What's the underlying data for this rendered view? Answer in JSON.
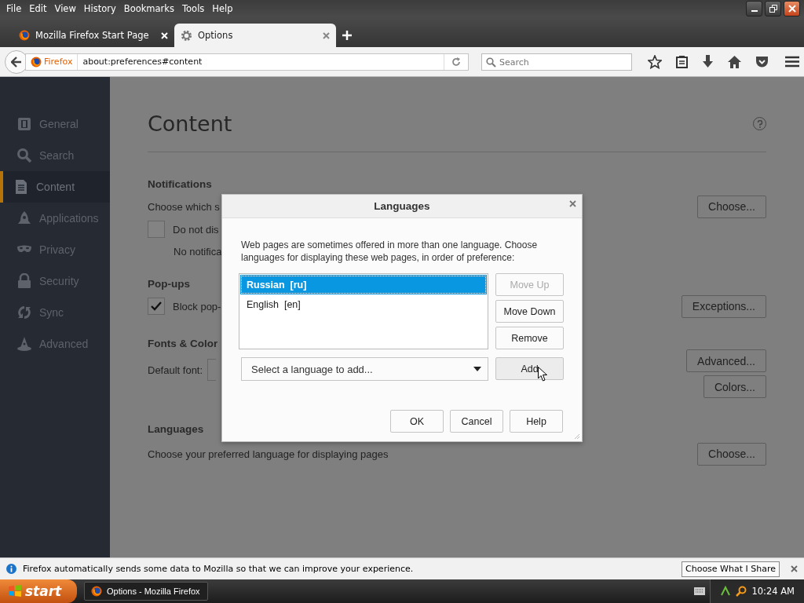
{
  "menu": [
    "File",
    "Edit",
    "View",
    "History",
    "Bookmarks",
    "Tools",
    "Help"
  ],
  "tabs": [
    {
      "label": "Mozilla Firefox Start Page",
      "selected": false,
      "kind": "firefox"
    },
    {
      "label": "Options",
      "selected": true,
      "kind": "gear"
    }
  ],
  "navbar": {
    "identity": "Firefox",
    "url": "about:preferences#content",
    "search": {
      "placeholder": "Search"
    }
  },
  "sidebar": {
    "items": [
      {
        "label": "General",
        "kind": "general",
        "selected": false
      },
      {
        "label": "Search",
        "kind": "search",
        "selected": false
      },
      {
        "label": "Content",
        "kind": "content",
        "selected": true
      },
      {
        "label": "Applications",
        "kind": "applications",
        "selected": false
      },
      {
        "label": "Privacy",
        "kind": "privacy",
        "selected": false
      },
      {
        "label": "Security",
        "kind": "security",
        "selected": false
      },
      {
        "label": "Sync",
        "kind": "sync",
        "selected": false
      },
      {
        "label": "Advanced",
        "kind": "advanced",
        "selected": false
      }
    ]
  },
  "content": {
    "title": "Content",
    "notifications": {
      "heading": "Notifications",
      "text": "Choose which s",
      "button": "Choose...",
      "checkbox": {
        "label": "Do not dis",
        "checked": false
      },
      "note": "No notifica"
    },
    "popups": {
      "heading": "Pop-ups",
      "checkbox": {
        "label": "Block pop-",
        "checked": true
      },
      "button": "Exceptions..."
    },
    "fonts": {
      "heading": "Fonts & Color",
      "label": "Default font:",
      "buttons": [
        "Advanced...",
        "Colors..."
      ]
    },
    "languages": {
      "heading": "Languages",
      "text": "Choose your preferred language for displaying pages",
      "button": "Choose..."
    }
  },
  "dialog": {
    "title": "Languages",
    "description": "Web pages are sometimes offered in more than one language. Choose languages for displaying these web pages, in order of preference:",
    "languages": [
      {
        "label": "Russian  [ru]",
        "selected": true
      },
      {
        "label": "English  [en]",
        "selected": false
      }
    ],
    "side_buttons": [
      {
        "label": "Move Up",
        "disabled": true
      },
      {
        "label": "Move Down",
        "disabled": false
      },
      {
        "label": "Remove",
        "disabled": false
      }
    ],
    "select": {
      "placeholder": "Select a language to add..."
    },
    "add": "Add",
    "buttons": [
      "OK",
      "Cancel",
      "Help"
    ]
  },
  "notification_bar": {
    "text": "Firefox automatically sends some data to Mozilla so that we can improve your experience.",
    "button": "Choose What I Share"
  },
  "taskbar": {
    "start": "start",
    "task": "Options - Mozilla Firefox",
    "clock": "10:24 AM"
  }
}
